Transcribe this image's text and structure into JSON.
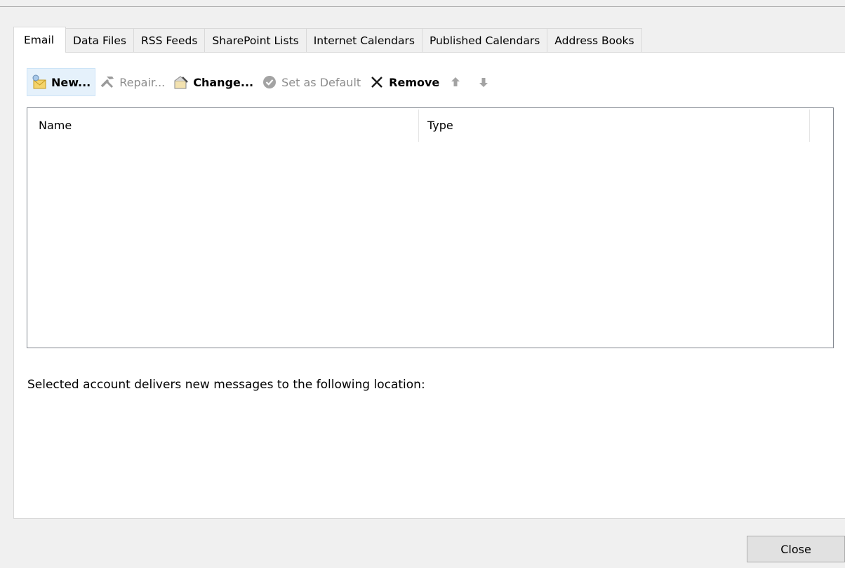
{
  "tabs": [
    {
      "label": "Email",
      "active": true
    },
    {
      "label": "Data Files"
    },
    {
      "label": "RSS Feeds"
    },
    {
      "label": "SharePoint Lists"
    },
    {
      "label": "Internet Calendars"
    },
    {
      "label": "Published Calendars"
    },
    {
      "label": "Address Books"
    }
  ],
  "toolbar": {
    "new_label": "New...",
    "repair_label": "Repair...",
    "change_label": "Change...",
    "set_default_label": "Set as Default",
    "remove_label": "Remove"
  },
  "list": {
    "columns": [
      "Name",
      "Type"
    ],
    "rows": []
  },
  "delivery_note": "Selected account delivers new messages to the following location:",
  "footer": {
    "close_label": "Close"
  },
  "colors": {
    "hover_bg": "#e5f1fb",
    "panel_bg": "#ffffff",
    "dialog_bg": "#f0f0f0"
  }
}
